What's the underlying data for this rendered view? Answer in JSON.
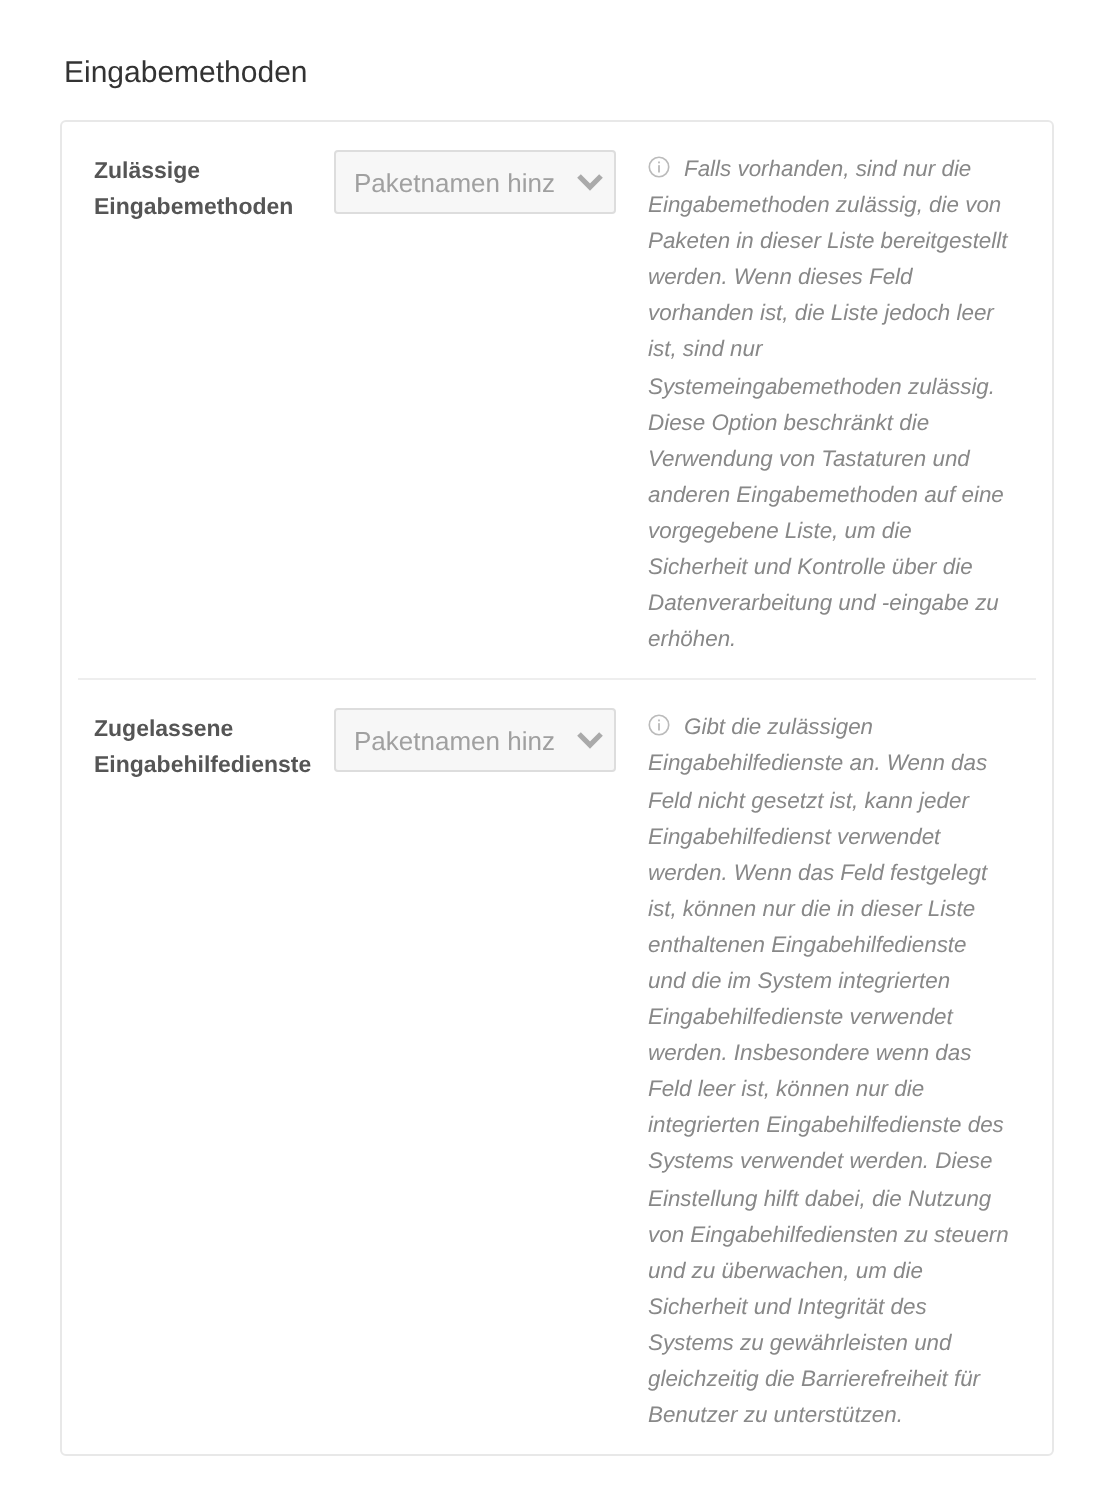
{
  "section": {
    "title": "Eingabemethoden"
  },
  "settings": [
    {
      "label": "Zulässige Eingabemethoden",
      "placeholder": "Paketnamen hinz",
      "description": "Falls vorhanden, sind nur die Eingabemethoden zulässig, die von Paketen in dieser Liste bereitgestellt werden. Wenn dieses Feld vorhanden ist, die Liste jedoch leer ist, sind nur Systemeingabemethoden zulässig. Diese Option beschränkt die Verwendung von Tastaturen und anderen Eingabemethoden auf eine vorgegebene Liste, um die Sicherheit und Kontrolle über die Datenverarbeitung und -eingabe zu erhöhen."
    },
    {
      "label": "Zugelassene Eingabehilfedienste",
      "placeholder": "Paketnamen hinz",
      "description": "Gibt die zulässigen Eingabehilfedienste an. Wenn das Feld nicht gesetzt ist, kann jeder Eingabehilfedienst verwendet werden. Wenn das Feld festgelegt ist, können nur die in dieser Liste enthaltenen Eingabehilfedienste und die im System integrierten Eingabehilfedienste verwendet werden. Insbesondere wenn das Feld leer ist, können nur die integrierten Eingabehilfedienste des Systems verwendet werden. Diese Einstellung hilft dabei, die Nutzung von Eingabehilfediensten zu steuern und zu überwachen, um die Sicherheit und Integrität des Systems zu gewährleisten und gleichzeitig die Barrierefreiheit für Benutzer zu unterstützen."
    }
  ]
}
